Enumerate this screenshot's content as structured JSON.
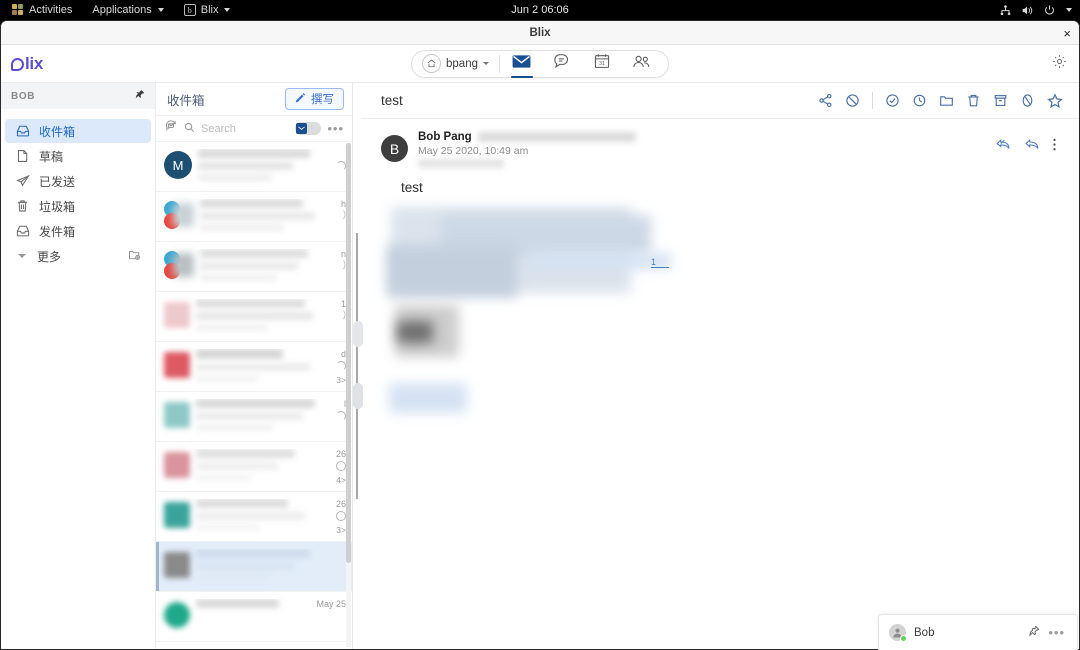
{
  "desktop": {
    "activities_label": "Activities",
    "applications_label": "Applications",
    "app_menu_label": "Blix",
    "clock": "Jun 2 06:06",
    "tray_icons": [
      "network-icon",
      "volume-icon",
      "power-icon",
      "caret-down-icon"
    ]
  },
  "window": {
    "title": "Blix",
    "close_label": "×"
  },
  "header": {
    "logo_text": "lix",
    "account": {
      "name": "bpang",
      "home_icon": "home-icon",
      "caret": "caret-down-icon"
    },
    "tabs": [
      {
        "name": "mail",
        "icon": "mail-icon",
        "active": true
      },
      {
        "name": "chat",
        "icon": "chat-bubble-icon",
        "active": false
      },
      {
        "name": "calendar",
        "icon": "calendar-icon",
        "day": "31",
        "active": false
      },
      {
        "name": "contacts",
        "icon": "people-icon",
        "active": false
      }
    ],
    "settings_icon": "gear-icon"
  },
  "sidebar": {
    "account_label": "BOB",
    "pin_icon": "pin-icon",
    "items": [
      {
        "label": "收件箱",
        "icon": "inbox-icon",
        "active": true
      },
      {
        "label": "草稿",
        "icon": "draft-icon",
        "active": false
      },
      {
        "label": "已发送",
        "icon": "sent-icon",
        "active": false
      },
      {
        "label": "垃圾箱",
        "icon": "trash-icon",
        "active": false
      },
      {
        "label": "发件箱",
        "icon": "outbox-icon",
        "active": false
      },
      {
        "label": "更多",
        "icon": "caret-down-icon",
        "trailing_icon": "folder-settings-icon",
        "active": false
      }
    ]
  },
  "mail_list": {
    "title": "收件箱",
    "compose_label": "撰写",
    "compose_icon": "pencil-icon",
    "sync_icon": "sync-mail-icon",
    "search_icon": "search-icon",
    "search_placeholder": "Search",
    "toggle_on": true,
    "toggle_icon": "mail-icon",
    "overflow_icon": "more-dots-icon",
    "items": [
      {
        "avatar_type": "letter",
        "avatar_letter": "M",
        "avatar_color": "#1c4f72",
        "redacted": true,
        "date": "",
        "count": ""
      },
      {
        "avatar_type": "stack",
        "avatar_color": "#3aa7d4",
        "avatar_color2": "#e8453c",
        "redacted": true,
        "date": "",
        "count": ""
      },
      {
        "avatar_type": "stack",
        "avatar_color": "#3aa7d4",
        "avatar_color2": "#e8453c",
        "redacted": true,
        "date": "",
        "count": ""
      },
      {
        "avatar_type": "square",
        "avatar_color": "#eec9cc",
        "redacted": true,
        "date": "",
        "count": ""
      },
      {
        "avatar_type": "square",
        "avatar_color": "#dd5a63",
        "redacted": true,
        "date": "d",
        "count": "3>"
      },
      {
        "avatar_type": "square",
        "avatar_color": "#8ec9c6",
        "redacted": true,
        "date": "l",
        "count": ""
      },
      {
        "avatar_type": "square",
        "avatar_color": "#d9949c",
        "redacted": true,
        "date": "26",
        "count": "4>"
      },
      {
        "avatar_type": "square",
        "avatar_color": "#3aa49b",
        "redacted": true,
        "date": "26",
        "count": "3>"
      },
      {
        "avatar_type": "square",
        "avatar_color": "#8a8a8a",
        "redacted": true,
        "date": "",
        "count": "",
        "selected": true
      },
      {
        "avatar_type": "square",
        "avatar_color": "#1fa98a",
        "redacted": true,
        "date": "May 25",
        "count": ""
      }
    ]
  },
  "reading_pane": {
    "subject": "test",
    "toolbar": [
      {
        "name": "share-icon"
      },
      {
        "name": "block-icon"
      },
      {
        "name": "divider"
      },
      {
        "name": "check-circle-icon"
      },
      {
        "name": "snooze-clock-icon"
      },
      {
        "name": "folder-icon"
      },
      {
        "name": "trash-icon"
      },
      {
        "name": "archive-icon"
      },
      {
        "name": "circle-slash-icon"
      },
      {
        "name": "star-icon"
      }
    ],
    "message": {
      "avatar_letter": "B",
      "sender": "Bob Pang",
      "sender_redacted": true,
      "date": "May 25 2020, 10:49 am",
      "body_text": "test",
      "actions": [
        "reply-all-icon",
        "reply-icon",
        "more-vertical-icon"
      ],
      "content_redacted": true
    }
  },
  "chat_dock": {
    "name": "Bob",
    "status": "online",
    "pin_icon": "pin-icon",
    "overflow_icon": "more-dots-icon"
  },
  "colors": {
    "accent_blue": "#3b6fd4",
    "brand_purple": "#5a4fcf",
    "selected_bg": "#dbe9fb",
    "tab_active": "#1a4f8f",
    "online_green": "#5fd35f"
  }
}
